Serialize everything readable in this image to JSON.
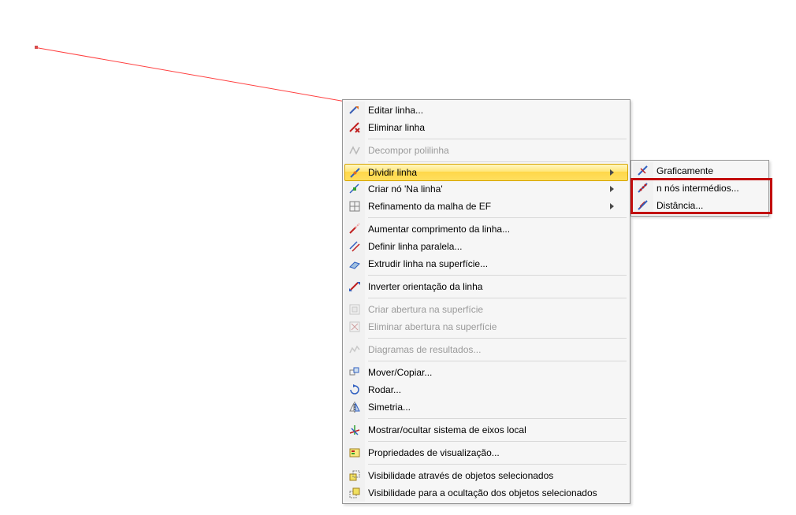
{
  "menu": {
    "items": [
      {
        "label": "Editar linha...",
        "icon": "edit-line-icon"
      },
      {
        "label": "Eliminar linha",
        "icon": "delete-line-icon"
      },
      {
        "sep": true
      },
      {
        "label": "Decompor polilinha",
        "icon": "decompose-polyline-icon",
        "disabled": true
      },
      {
        "sep": true
      },
      {
        "label": "Dividir linha",
        "icon": "divide-line-icon",
        "arrow": true,
        "highlight": true
      },
      {
        "label": "Criar nó 'Na linha'",
        "icon": "node-on-line-icon",
        "arrow": true
      },
      {
        "label": "Refinamento da malha de EF",
        "icon": "mesh-refine-icon",
        "arrow": true
      },
      {
        "sep": true
      },
      {
        "label": "Aumentar comprimento da linha...",
        "icon": "extend-line-icon"
      },
      {
        "label": "Definir linha paralela...",
        "icon": "parallel-line-icon"
      },
      {
        "label": "Extrudir linha na superfície...",
        "icon": "extrude-line-icon"
      },
      {
        "sep": true
      },
      {
        "label": "Inverter orientação da linha",
        "icon": "reverse-line-icon"
      },
      {
        "sep": true
      },
      {
        "label": "Criar abertura na superfície",
        "icon": "create-opening-icon",
        "disabled": true
      },
      {
        "label": "Eliminar abertura na superfície",
        "icon": "delete-opening-icon",
        "disabled": true
      },
      {
        "sep": true
      },
      {
        "label": "Diagramas de resultados...",
        "icon": "result-diagrams-icon",
        "disabled": true
      },
      {
        "sep": true
      },
      {
        "label": "Mover/Copiar...",
        "icon": "move-copy-icon"
      },
      {
        "label": "Rodar...",
        "icon": "rotate-icon"
      },
      {
        "label": "Simetria...",
        "icon": "mirror-icon"
      },
      {
        "sep": true
      },
      {
        "label": "Mostrar/ocultar sistema de eixos local",
        "icon": "axes-icon"
      },
      {
        "sep": true
      },
      {
        "label": "Propriedades de visualização...",
        "icon": "display-props-icon"
      },
      {
        "sep": true
      },
      {
        "label": "Visibilidade através de objetos selecionados",
        "icon": "visibility-by-icon"
      },
      {
        "label": "Visibilidade para a ocultação dos objetos selecionados",
        "icon": "visibility-hide-icon"
      }
    ]
  },
  "submenu": {
    "items": [
      {
        "label": "Graficamente",
        "icon": "divide-graph-icon"
      },
      {
        "label": "n nós intermédios...",
        "icon": "divide-n-icon"
      },
      {
        "label": "Distância...",
        "icon": "divide-dist-icon"
      }
    ]
  },
  "colors": {
    "highlight_border": "#d6a400",
    "red_annotation": "#c20e0e",
    "line": "#ff4040"
  }
}
